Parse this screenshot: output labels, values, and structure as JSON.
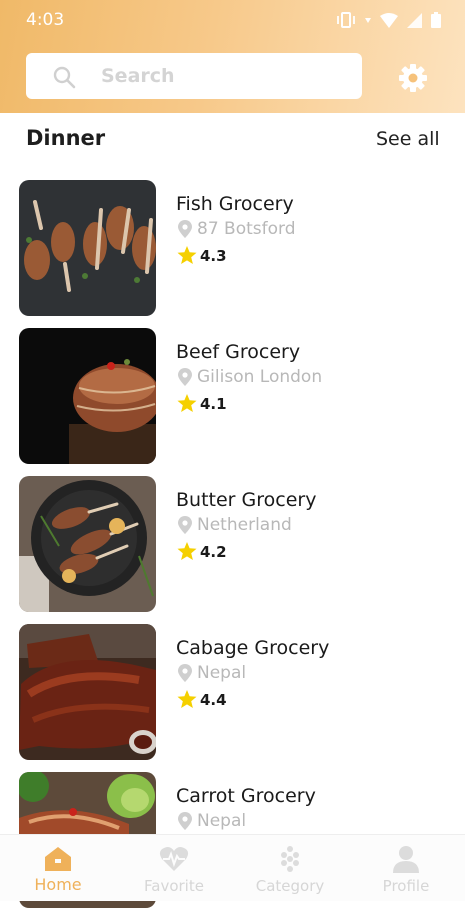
{
  "status_bar": {
    "time": "4:03"
  },
  "search": {
    "placeholder": "Search"
  },
  "section": {
    "title": "Dinner",
    "see_all": "See all"
  },
  "stores": [
    {
      "name": "Fish Grocery",
      "location": "87 Botsford",
      "rating": "4.3"
    },
    {
      "name": "Beef Grocery",
      "location": "Gilison London",
      "rating": "4.1"
    },
    {
      "name": "Butter Grocery",
      "location": "Netherland",
      "rating": "4.2"
    },
    {
      "name": "Cabage Grocery",
      "location": "Nepal",
      "rating": "4.4"
    },
    {
      "name": "Carrot Grocery",
      "location": "Nepal",
      "rating": ""
    }
  ],
  "nav": {
    "home": "Home",
    "favorite": "Favorite",
    "category": "Category",
    "profile": "Profile"
  },
  "colors": {
    "accent": "#efb15a",
    "header_start": "#f0b968",
    "header_end": "#fde3bf",
    "star": "#f5d000"
  },
  "icons": {
    "search": "search-icon",
    "settings": "gear-icon",
    "location": "location-pin-icon",
    "rating": "star-icon",
    "home": "home-icon",
    "favorite": "heart-pulse-icon",
    "category": "grid-dots-icon",
    "profile": "person-icon"
  }
}
